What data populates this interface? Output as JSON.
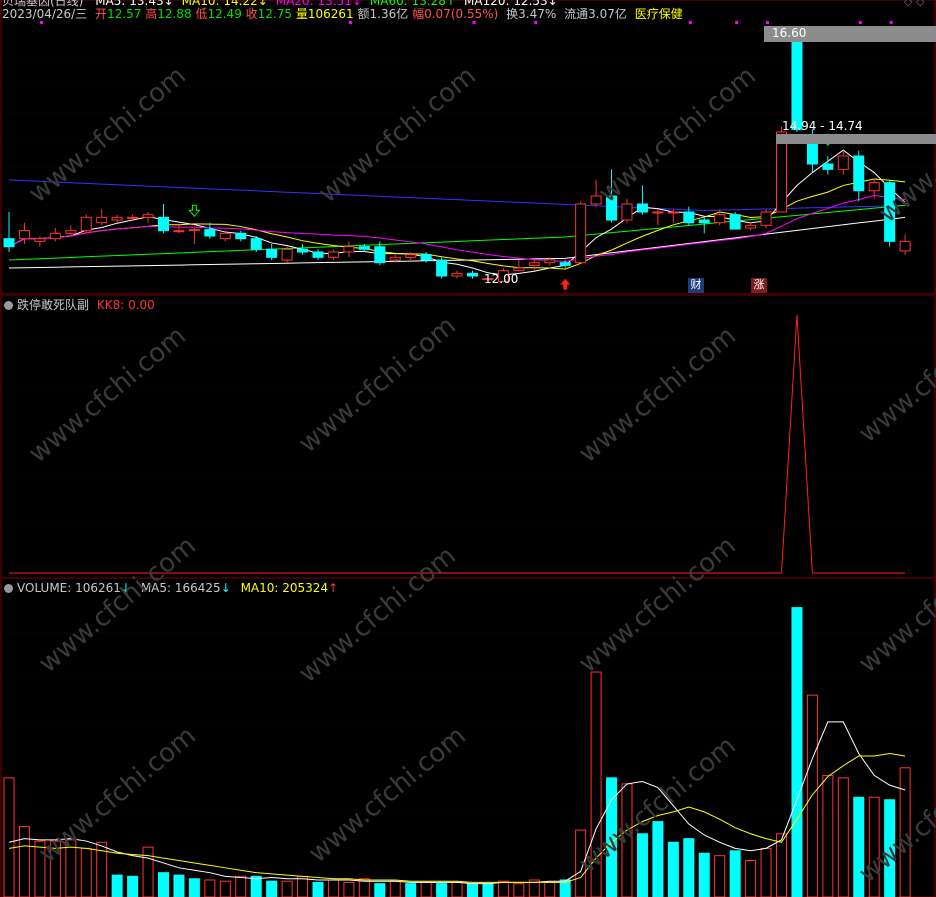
{
  "header": {
    "title_partial": "贝瑞基因(日线)",
    "ma_partial": [
      {
        "label": "MA5: 13.43",
        "arrow": "↓",
        "color": "#ffffff"
      },
      {
        "label": "MA10: 14.22",
        "arrow": "↓",
        "color": "#ffff00"
      },
      {
        "label": "MA20: 13.51",
        "arrow": "↓",
        "color": "#ff00ff"
      },
      {
        "label": "MA60: 13.28",
        "arrow": "↑",
        "color": "#00ff00"
      },
      {
        "label": "MA120: 12.53",
        "arrow": "↓",
        "color": "#ffffff"
      }
    ],
    "date": "2023/04/26/三",
    "open_label": "开",
    "open": "12.57",
    "high_label": "高",
    "high": "12.88",
    "low_label": "低",
    "low": "12.49",
    "close_label": "收",
    "close": "12.75",
    "vol_label": "量",
    "vol": "106261",
    "amt_label": "额",
    "amt": "1.36亿",
    "chg_label": "幅",
    "chg": "0.07(0.55%)",
    "turn_label": "换",
    "turn": "3.47%",
    "float_label": "流通",
    "float": "3.07亿",
    "sector": "医疗保健"
  },
  "price_annotations": {
    "max_label": "16.60",
    "range_label": "14.94 - 14.74",
    "min_label": "12.00",
    "badge_cai": "财",
    "badge_zhang": "涨"
  },
  "indicator_panel": {
    "title": "跌停敢死队副",
    "kk8_label": "KK8: 0.00"
  },
  "volume_panel": {
    "vol_label": "VOLUME: 106261",
    "vol_arrow": "↓",
    "ma5_label": "MA5: 166425",
    "ma5_arrow": "↓",
    "ma10_label": "MA10: 205324",
    "ma10_arrow": "↑"
  },
  "watermark": "www.cfchi.com",
  "colors": {
    "up": "#ff3232",
    "down": "#00ffff",
    "ma5": "#ffffff",
    "ma10": "#ffff00",
    "ma20": "#ff00ff",
    "ma60": "#00ff00",
    "ma120": "#ffffff",
    "long": "#3232ff",
    "grid": "#800000"
  },
  "chart_data": [
    {
      "type": "candlestick",
      "title": "贝瑞基因(日线)",
      "ylim": [
        11.8,
        16.9
      ],
      "series": [
        {
          "o": 12.8,
          "h": 13.3,
          "l": 12.55,
          "c": 12.65
        },
        {
          "o": 12.8,
          "h": 13.1,
          "l": 12.7,
          "c": 12.95
        },
        {
          "o": 12.75,
          "h": 12.85,
          "l": 12.65,
          "c": 12.8
        },
        {
          "o": 12.8,
          "h": 13.0,
          "l": 12.75,
          "c": 12.9
        },
        {
          "o": 12.9,
          "h": 13.05,
          "l": 12.85,
          "c": 12.95
        },
        {
          "o": 12.95,
          "h": 13.25,
          "l": 12.9,
          "c": 13.2
        },
        {
          "o": 13.1,
          "h": 13.35,
          "l": 13.05,
          "c": 13.2
        },
        {
          "o": 13.15,
          "h": 13.25,
          "l": 13.1,
          "c": 13.2
        },
        {
          "o": 13.2,
          "h": 13.25,
          "l": 13.15,
          "c": 13.2
        },
        {
          "o": 13.2,
          "h": 13.3,
          "l": 13.1,
          "c": 13.25
        },
        {
          "o": 13.2,
          "h": 13.45,
          "l": 12.9,
          "c": 12.95
        },
        {
          "o": 12.95,
          "h": 13.05,
          "l": 12.9,
          "c": 12.95
        },
        {
          "o": 12.95,
          "h": 13.0,
          "l": 12.7,
          "c": 12.97
        },
        {
          "o": 12.97,
          "h": 13.1,
          "l": 12.8,
          "c": 12.85
        },
        {
          "o": 12.8,
          "h": 12.95,
          "l": 12.75,
          "c": 12.9
        },
        {
          "o": 12.9,
          "h": 12.95,
          "l": 12.75,
          "c": 12.8
        },
        {
          "o": 12.8,
          "h": 12.85,
          "l": 12.55,
          "c": 12.6
        },
        {
          "o": 12.6,
          "h": 12.7,
          "l": 12.4,
          "c": 12.45
        },
        {
          "o": 12.4,
          "h": 12.65,
          "l": 12.35,
          "c": 12.6
        },
        {
          "o": 12.6,
          "h": 12.7,
          "l": 12.5,
          "c": 12.55
        },
        {
          "o": 12.55,
          "h": 12.6,
          "l": 12.4,
          "c": 12.45
        },
        {
          "o": 12.45,
          "h": 12.6,
          "l": 12.4,
          "c": 12.55
        },
        {
          "o": 12.55,
          "h": 12.75,
          "l": 12.45,
          "c": 12.65
        },
        {
          "o": 12.65,
          "h": 12.7,
          "l": 12.55,
          "c": 12.6
        },
        {
          "o": 12.65,
          "h": 12.75,
          "l": 12.3,
          "c": 12.35
        },
        {
          "o": 12.4,
          "h": 12.5,
          "l": 12.35,
          "c": 12.45
        },
        {
          "o": 12.45,
          "h": 12.55,
          "l": 12.4,
          "c": 12.5
        },
        {
          "o": 12.5,
          "h": 12.55,
          "l": 12.35,
          "c": 12.4
        },
        {
          "o": 12.4,
          "h": 12.45,
          "l": 12.05,
          "c": 12.1
        },
        {
          "o": 12.1,
          "h": 12.2,
          "l": 12.05,
          "c": 12.15
        },
        {
          "o": 12.15,
          "h": 12.2,
          "l": 12.05,
          "c": 12.1
        },
        {
          "o": 12.05,
          "h": 12.1,
          "l": 12.0,
          "c": 12.05
        },
        {
          "o": 12.0,
          "h": 12.25,
          "l": 12.0,
          "c": 12.2
        },
        {
          "o": 12.2,
          "h": 12.4,
          "l": 12.2,
          "c": 12.25
        },
        {
          "o": 12.3,
          "h": 12.4,
          "l": 12.2,
          "c": 12.35
        },
        {
          "o": 12.35,
          "h": 12.45,
          "l": 12.3,
          "c": 12.4
        },
        {
          "o": 12.35,
          "h": 12.4,
          "l": 12.25,
          "c": 12.3
        },
        {
          "o": 12.35,
          "h": 13.5,
          "l": 12.35,
          "c": 13.45
        },
        {
          "o": 13.45,
          "h": 13.9,
          "l": 13.4,
          "c": 13.6
        },
        {
          "o": 13.6,
          "h": 14.1,
          "l": 13.1,
          "c": 13.15
        },
        {
          "o": 13.15,
          "h": 13.55,
          "l": 13.1,
          "c": 13.45
        },
        {
          "o": 13.45,
          "h": 13.8,
          "l": 13.25,
          "c": 13.3
        },
        {
          "o": 13.3,
          "h": 13.35,
          "l": 13.05,
          "c": 13.3
        },
        {
          "o": 13.3,
          "h": 13.35,
          "l": 13.1,
          "c": 13.3
        },
        {
          "o": 13.3,
          "h": 13.4,
          "l": 13.05,
          "c": 13.1
        },
        {
          "o": 13.15,
          "h": 13.2,
          "l": 12.9,
          "c": 13.1
        },
        {
          "o": 13.1,
          "h": 13.35,
          "l": 13.05,
          "c": 13.25
        },
        {
          "o": 13.25,
          "h": 13.3,
          "l": 13.0,
          "c": 12.98
        },
        {
          "o": 13.0,
          "h": 13.1,
          "l": 12.95,
          "c": 13.05
        },
        {
          "o": 13.05,
          "h": 13.35,
          "l": 13.0,
          "c": 13.3
        },
        {
          "o": 13.3,
          "h": 14.9,
          "l": 13.3,
          "c": 14.8
        },
        {
          "o": 16.6,
          "h": 16.6,
          "l": 14.8,
          "c": 14.85
        },
        {
          "o": 14.6,
          "h": 14.85,
          "l": 14.05,
          "c": 14.2
        },
        {
          "o": 14.2,
          "h": 14.35,
          "l": 14.0,
          "c": 14.1
        },
        {
          "o": 14.1,
          "h": 14.45,
          "l": 14.0,
          "c": 14.35
        },
        {
          "o": 14.35,
          "h": 14.45,
          "l": 13.5,
          "c": 13.7
        },
        {
          "o": 13.7,
          "h": 13.9,
          "l": 13.55,
          "c": 13.85
        },
        {
          "o": 13.85,
          "h": 13.9,
          "l": 12.65,
          "c": 12.75
        },
        {
          "o": 12.57,
          "h": 12.88,
          "l": 12.49,
          "c": 12.75
        }
      ]
    },
    {
      "type": "line",
      "title": "跌停敢死队副",
      "series": [
        {
          "name": "KK8",
          "values": [
            0,
            0,
            0,
            0,
            0,
            0,
            0,
            0,
            0,
            0,
            0,
            0,
            0,
            0,
            0,
            0,
            0,
            0,
            0,
            0,
            0,
            0,
            0,
            0,
            0,
            0,
            0,
            0,
            0,
            0,
            0,
            0,
            0,
            0,
            0,
            0,
            0,
            0,
            0,
            0,
            0,
            0,
            0,
            0,
            0,
            0,
            0,
            0,
            0,
            0,
            0,
            100,
            0,
            0,
            0,
            0,
            0,
            0,
            0
          ]
        }
      ]
    },
    {
      "type": "bar",
      "title": "VOLUME",
      "values": [
        98000,
        58000,
        46000,
        46000,
        47000,
        40000,
        45000,
        18000,
        17000,
        41000,
        20000,
        18000,
        15000,
        14000,
        13000,
        17000,
        17000,
        13000,
        13000,
        17000,
        12000,
        14000,
        12000,
        15000,
        11000,
        13000,
        11000,
        12000,
        11000,
        12000,
        11000,
        11000,
        13000,
        11000,
        14000,
        12000,
        14000,
        55000,
        185000,
        98000,
        93000,
        52000,
        62000,
        45000,
        48000,
        36000,
        34000,
        38000,
        30000,
        40000,
        52000,
        238000,
        166000,
        100000,
        98000,
        82000,
        82000,
        80000,
        106261
      ],
      "up": [
        true,
        true,
        true,
        true,
        true,
        true,
        true,
        false,
        false,
        true,
        false,
        false,
        false,
        true,
        true,
        true,
        false,
        false,
        true,
        true,
        false,
        true,
        true,
        true,
        false,
        true,
        false,
        true,
        false,
        true,
        false,
        false,
        true,
        true,
        true,
        true,
        false,
        true,
        true,
        false,
        true,
        false,
        false,
        false,
        false,
        false,
        true,
        false,
        true,
        true,
        true,
        false,
        true,
        true,
        true,
        false,
        true,
        false,
        true
      ],
      "ma5": [
        45000,
        48000,
        47000,
        47000,
        48000,
        46000,
        42000,
        37000,
        34000,
        32000,
        28000,
        24000,
        22000,
        20000,
        17000,
        16000,
        15000,
        16000,
        15000,
        15000,
        14000,
        14000,
        14000,
        13000,
        13000,
        13000,
        12000,
        12000,
        12000,
        12000,
        11000,
        11000,
        12000,
        12000,
        12000,
        13000,
        13000,
        21000,
        56000,
        80000,
        93000,
        95000,
        90000,
        75000,
        60000,
        51000,
        45000,
        40000,
        38000,
        40000,
        47000,
        80000,
        114000,
        144000,
        144000,
        118000,
        100000,
        92000,
        88000
      ],
      "ma10": [
        40000,
        42000,
        41000,
        40000,
        41000,
        40000,
        38000,
        36000,
        35000,
        34000,
        32000,
        30000,
        28000,
        26000,
        24000,
        22000,
        20000,
        19000,
        18000,
        17000,
        16000,
        15000,
        15000,
        14000,
        14000,
        14000,
        13000,
        13000,
        13000,
        13000,
        12000,
        12000,
        12000,
        12000,
        12000,
        12000,
        12000,
        16000,
        32000,
        45000,
        55000,
        62000,
        67000,
        70000,
        74000,
        70000,
        64000,
        57000,
        52000,
        48000,
        45000,
        64000,
        84000,
        99000,
        108000,
        116000,
        116000,
        118000,
        116000
      ]
    }
  ]
}
